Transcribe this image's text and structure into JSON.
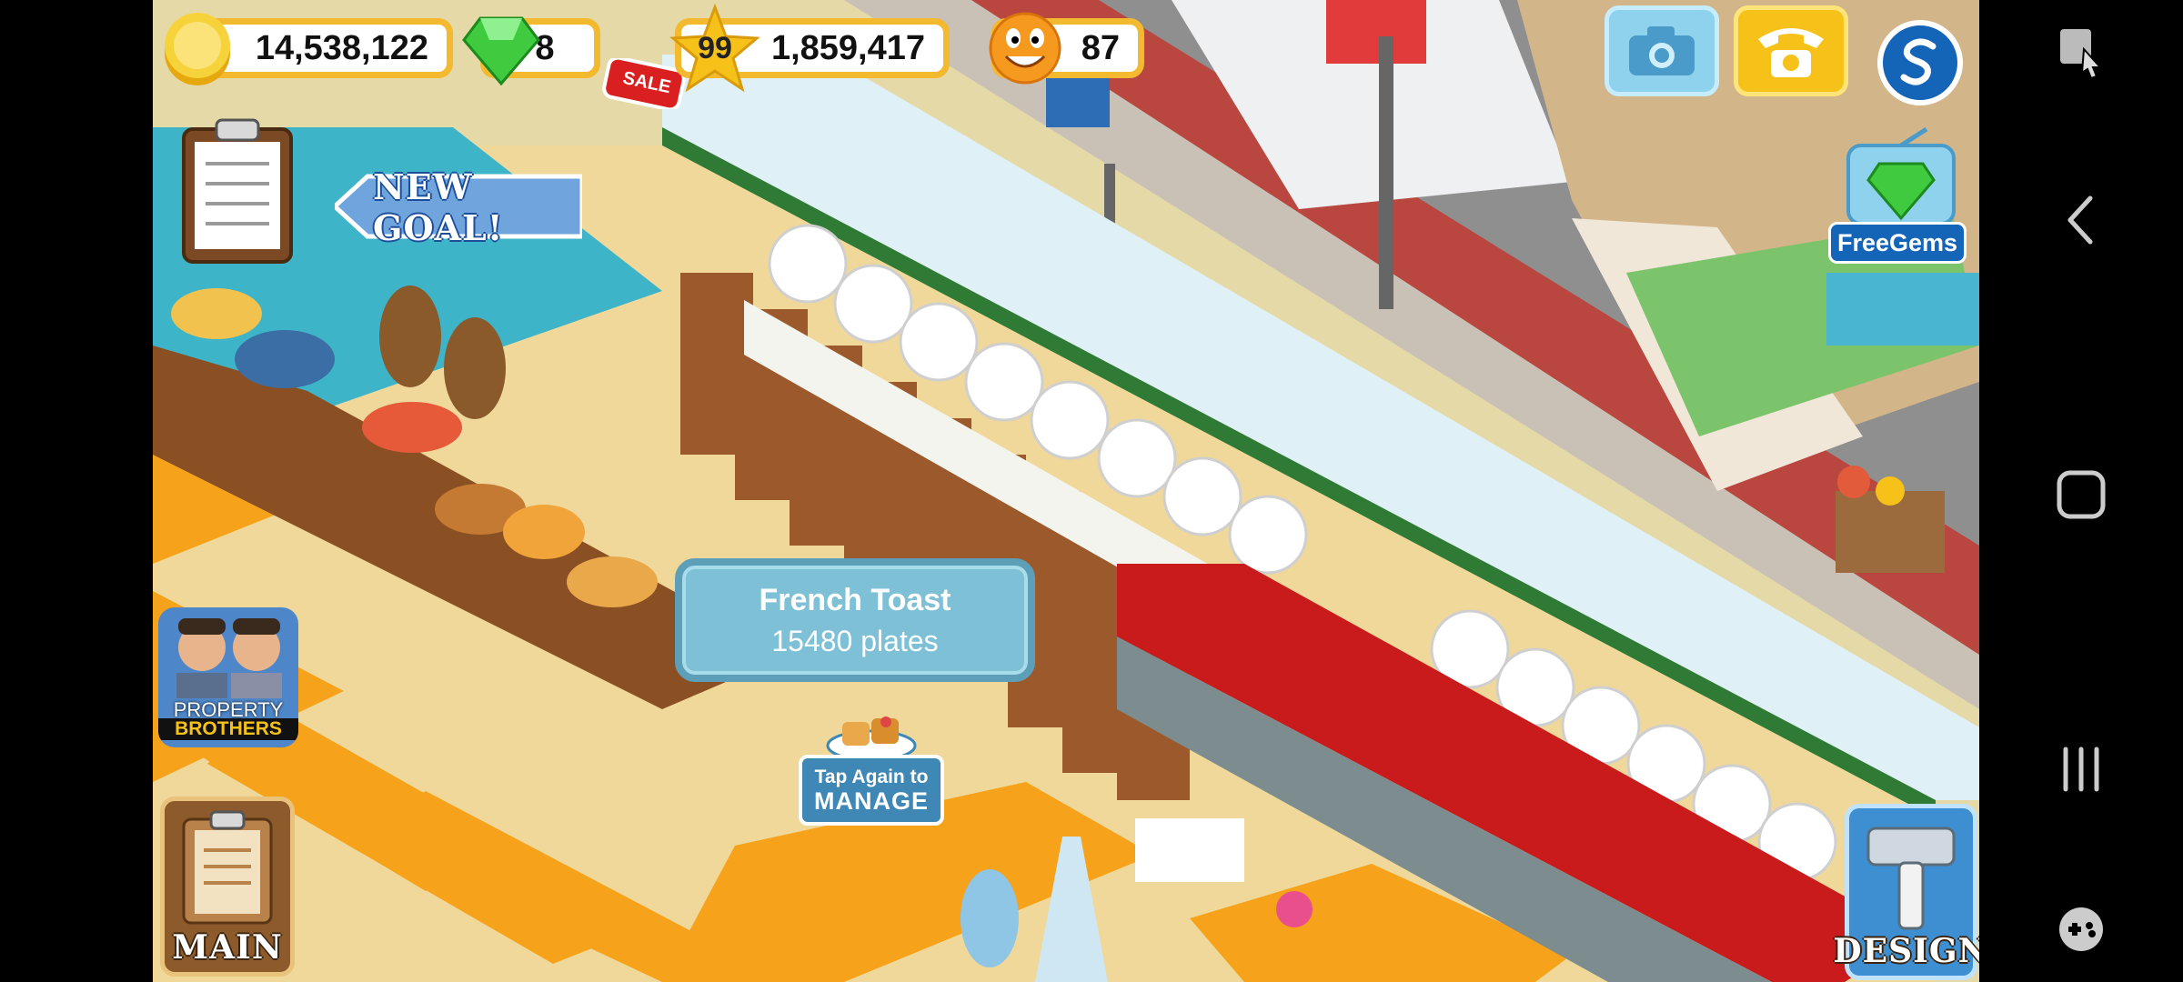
{
  "hud": {
    "coins": "14,538,122",
    "gems": "8",
    "sale_badge": "SALE",
    "level": "99",
    "xp": "1,859,417",
    "happiness": "87"
  },
  "top_right": {
    "free_gems_label": "FreeGems"
  },
  "goal_button": {
    "label": "NEW GOAL!"
  },
  "tooltip": {
    "dish_name": "French Toast",
    "servings": "15480 plates"
  },
  "manage_prompt": {
    "line1": "Tap Again to",
    "line2": "MANAGE"
  },
  "ad": {
    "line1": "PROPERTY",
    "line2": "BROTHERS"
  },
  "bottom_buttons": {
    "main_label": "MAIN",
    "design_label": "DESIGN"
  },
  "colors": {
    "hud_border": "#f3b92f",
    "tooltip_bg": "#7ec0d6",
    "manage_bg": "#3f88b6",
    "design_bg": "#3d8fd1"
  }
}
